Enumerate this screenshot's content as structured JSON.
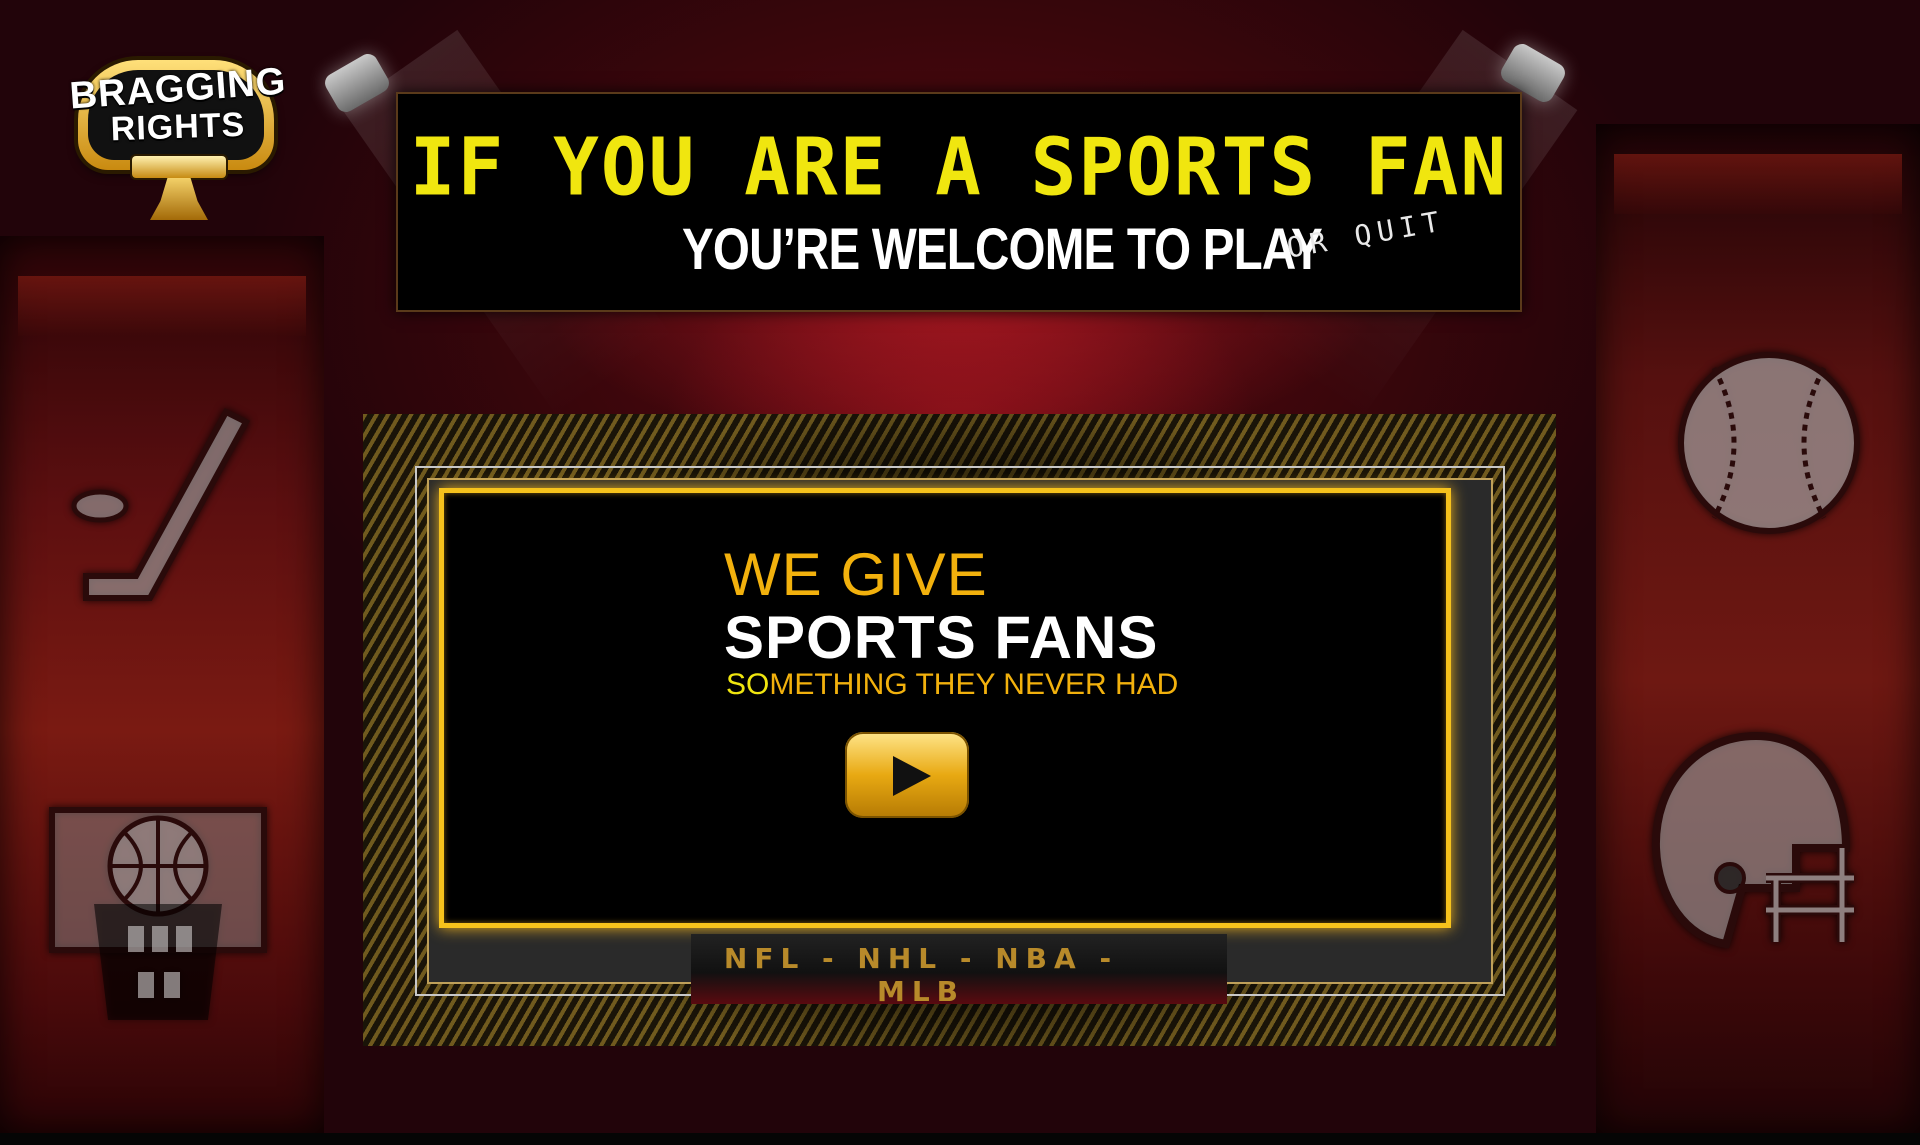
{
  "logo": {
    "line1": "BRAGGING",
    "line2": "RIGHTS"
  },
  "banner": {
    "headline": "IF YOU ARE A SPORTS FAN",
    "subline": "YOU’RE WELCOME TO PLAY",
    "alt": "OR QUIT"
  },
  "video": {
    "line1": "WE GIVE",
    "line2": "SPORTS FANS",
    "line3_highlight": "SO",
    "line3_rest": "METHING THEY NEVER HAD",
    "leagues": "NFL - NHL - NBA - MLB"
  },
  "colors": {
    "gold": "#f2b10d",
    "yellow": "#f0e60f",
    "background": "#1c0306"
  },
  "icons": [
    "hockey-stick-icon",
    "basketball-hoop-icon",
    "baseball-icon",
    "football-helmet-icon",
    "play-icon"
  ]
}
